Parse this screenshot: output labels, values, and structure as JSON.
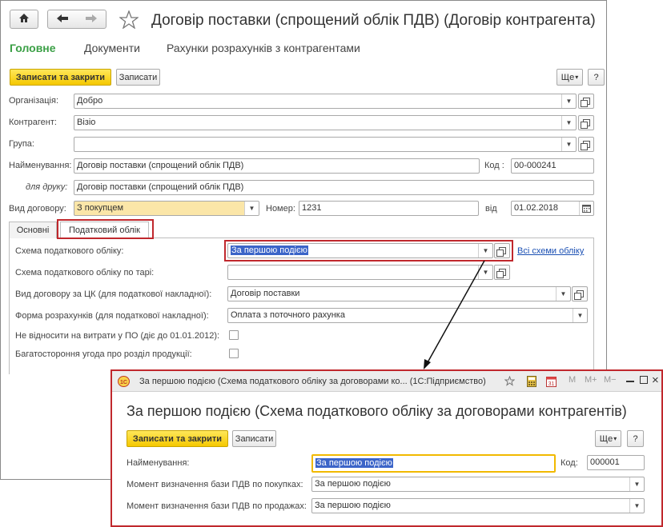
{
  "main": {
    "title": "Договір поставки (спрощений облік ПДВ) (Договір контрагента)",
    "icons": {
      "home": "home-icon",
      "back": "arrow-left-icon",
      "forward": "arrow-right-icon",
      "favorite": "star-icon"
    },
    "top_tabs": [
      "Головне",
      "Документи",
      "Рахунки розрахунків з контрагентами"
    ],
    "toolbar": {
      "save_close": "Записати та закрити",
      "save": "Записати",
      "more": "Ще",
      "more_arrow": "▾",
      "help": "?"
    },
    "fields": {
      "org_label": "Організація:",
      "org_value": "Добро",
      "counterparty_label": "Контрагент:",
      "counterparty_value": "Візіо",
      "group_label": "Група:",
      "group_value": "",
      "name_label": "Найменування:",
      "name_value": "Договір поставки (спрощений облік ПДВ)",
      "code_label": "Код :",
      "code_value": "00-000241",
      "print_label": "для друку:",
      "print_value": "Договір поставки (спрощений облік ПДВ)",
      "contract_type_label": "Вид договору:",
      "contract_type_value": "З покупцем",
      "number_label": "Номер:",
      "number_value": "1231",
      "date_label": "від",
      "date_value": "01.02.2018"
    },
    "tabs": [
      "Основні",
      "Податковий облік"
    ],
    "tax": {
      "scheme_label": "Схема податкового обліку:",
      "scheme_value": "За першою подією",
      "all_schemes_link": "Всі схеми обліку",
      "tare_label": "Схема податкового обліку по тарі:",
      "tare_value": "",
      "civil_label": "Вид договору за ЦК (для податкової накладної):",
      "civil_value": "Договір поставки",
      "payment_label": "Форма розрахунків (для податкової накладної):",
      "payment_value": "Оплата з поточного рахунка",
      "expenses_label": "Не відносити на витрати у ПО (діє до 01.01.2012):",
      "multi_label": "Багатостороння угода про розділ продукції:"
    }
  },
  "popup": {
    "window_title": "За першою подією (Схема податкового обліку за договорами ко...  (1С:Підприємство)",
    "heading": "За першою подією (Схема податкового обліку за договорами контрагентів)",
    "toolbar": {
      "save_close": "Записати та закрити",
      "save": "Записати",
      "more": "Ще",
      "more_arrow": "▾",
      "help": "?"
    },
    "titlebar_buttons": {
      "m": "M",
      "mplus": "M+",
      "mminus": "M−"
    },
    "name_label": "Найменування:",
    "name_value": "За першою подією",
    "code_label": "Код:",
    "code_value": "000001",
    "purchase_label": "Момент визначення бази ПДВ по покупках:",
    "purchase_value": "За першою подією",
    "sales_label": "Момент визначення бази ПДВ по продажах:",
    "sales_value": "За першою подією"
  },
  "colors": {
    "accent_green": "#3a9f45",
    "primary_yellow": "#f5c800",
    "highlight_red": "#c0282d",
    "link_blue": "#1a4fb3",
    "selection_blue": "#3b64c8"
  }
}
